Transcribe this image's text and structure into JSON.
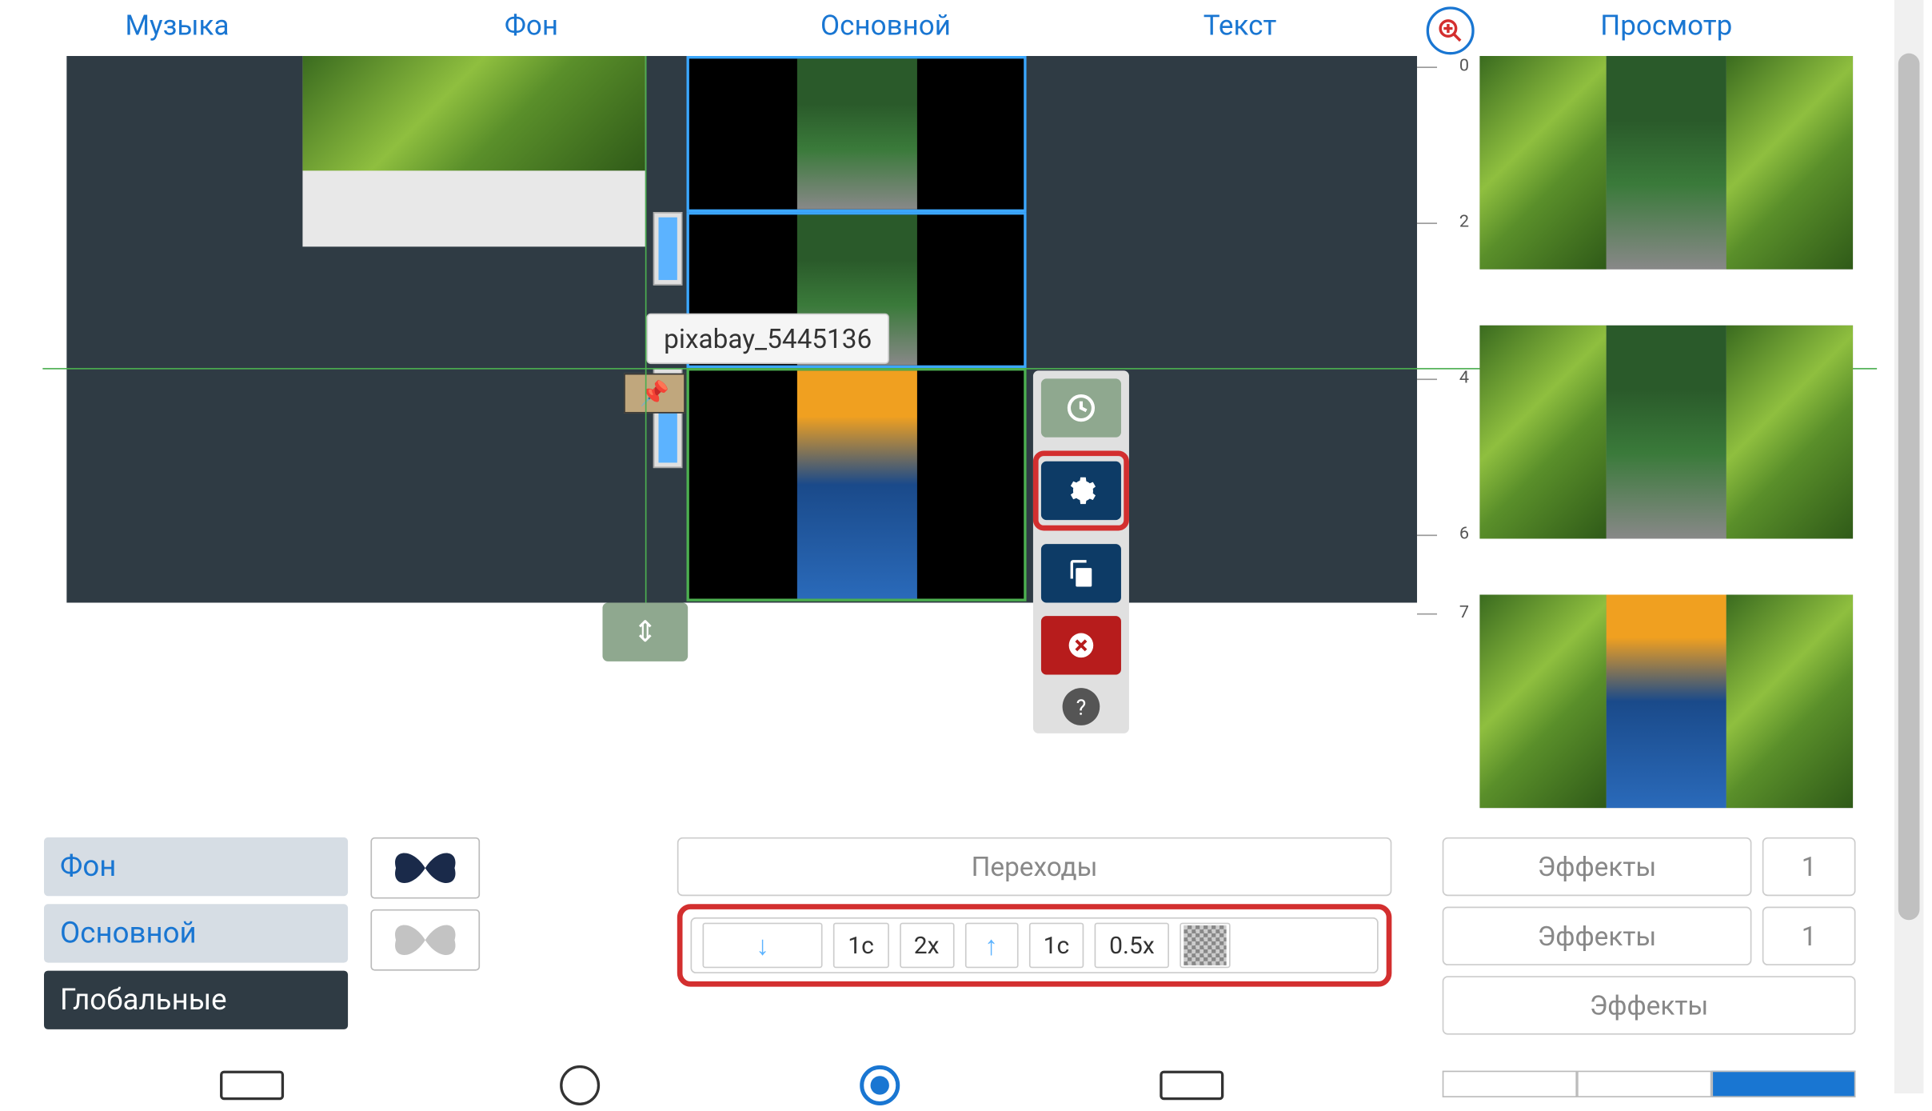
{
  "tabs": {
    "music": "Музыка",
    "background": "Фон",
    "main": "Основной",
    "text": "Текст",
    "preview": "Просмотр"
  },
  "tooltip": "pixabay_5445136",
  "ruler": {
    "marks": [
      "0",
      "2",
      "4",
      "6",
      "7"
    ]
  },
  "layers": {
    "background": "Фон",
    "main": "Основной",
    "global": "Глобальные"
  },
  "transitions": {
    "label": "Переходы",
    "in_time": "1c",
    "in_mult": "2x",
    "out_time": "1c",
    "out_mult": "0.5x"
  },
  "effects": {
    "label": "Эффекты",
    "count_1": "1",
    "count_2": "1"
  },
  "icons": {
    "pin": "📌",
    "resize": "⇕",
    "time": "clock",
    "gear": "gear",
    "copy": "copy",
    "delete": "delete",
    "help": "?"
  }
}
